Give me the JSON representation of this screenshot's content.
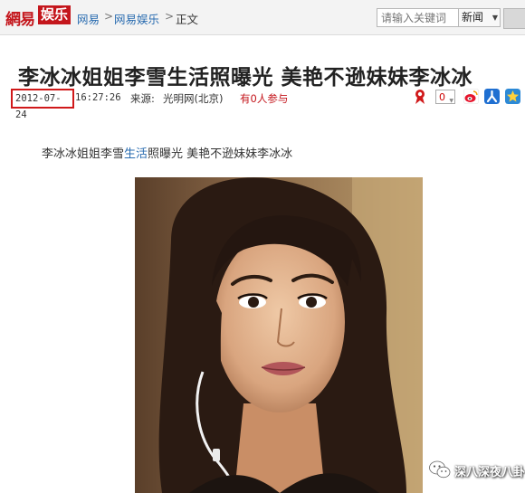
{
  "header": {
    "logo_netease": "網易",
    "logo_ent": "娱乐",
    "breadcrumb": [
      "网易",
      "网易娱乐",
      "正文"
    ],
    "separator": ">",
    "search_placeholder": "请输入关键词",
    "search_scope": "新闻"
  },
  "article": {
    "title": "李冰冰姐姐李雪生活照曝光 美艳不逊妹妹李冰冰",
    "date": "2012-07-24",
    "time": "16:27:26",
    "source_label": "来源:",
    "source": "光明网(北京)",
    "participants": "有0人参与",
    "comment_count": "0",
    "intro_before_link": "李冰冰姐姐李雪",
    "intro_link": "生活",
    "intro_after_link": "照曝光 美艳不逊妹妹李冰冰"
  },
  "watermark": {
    "text": "深八深夜八卦"
  },
  "colors": {
    "brand_red": "#c4161c",
    "link_blue": "#2a6cb0",
    "highlight_box": "#d0191a"
  }
}
